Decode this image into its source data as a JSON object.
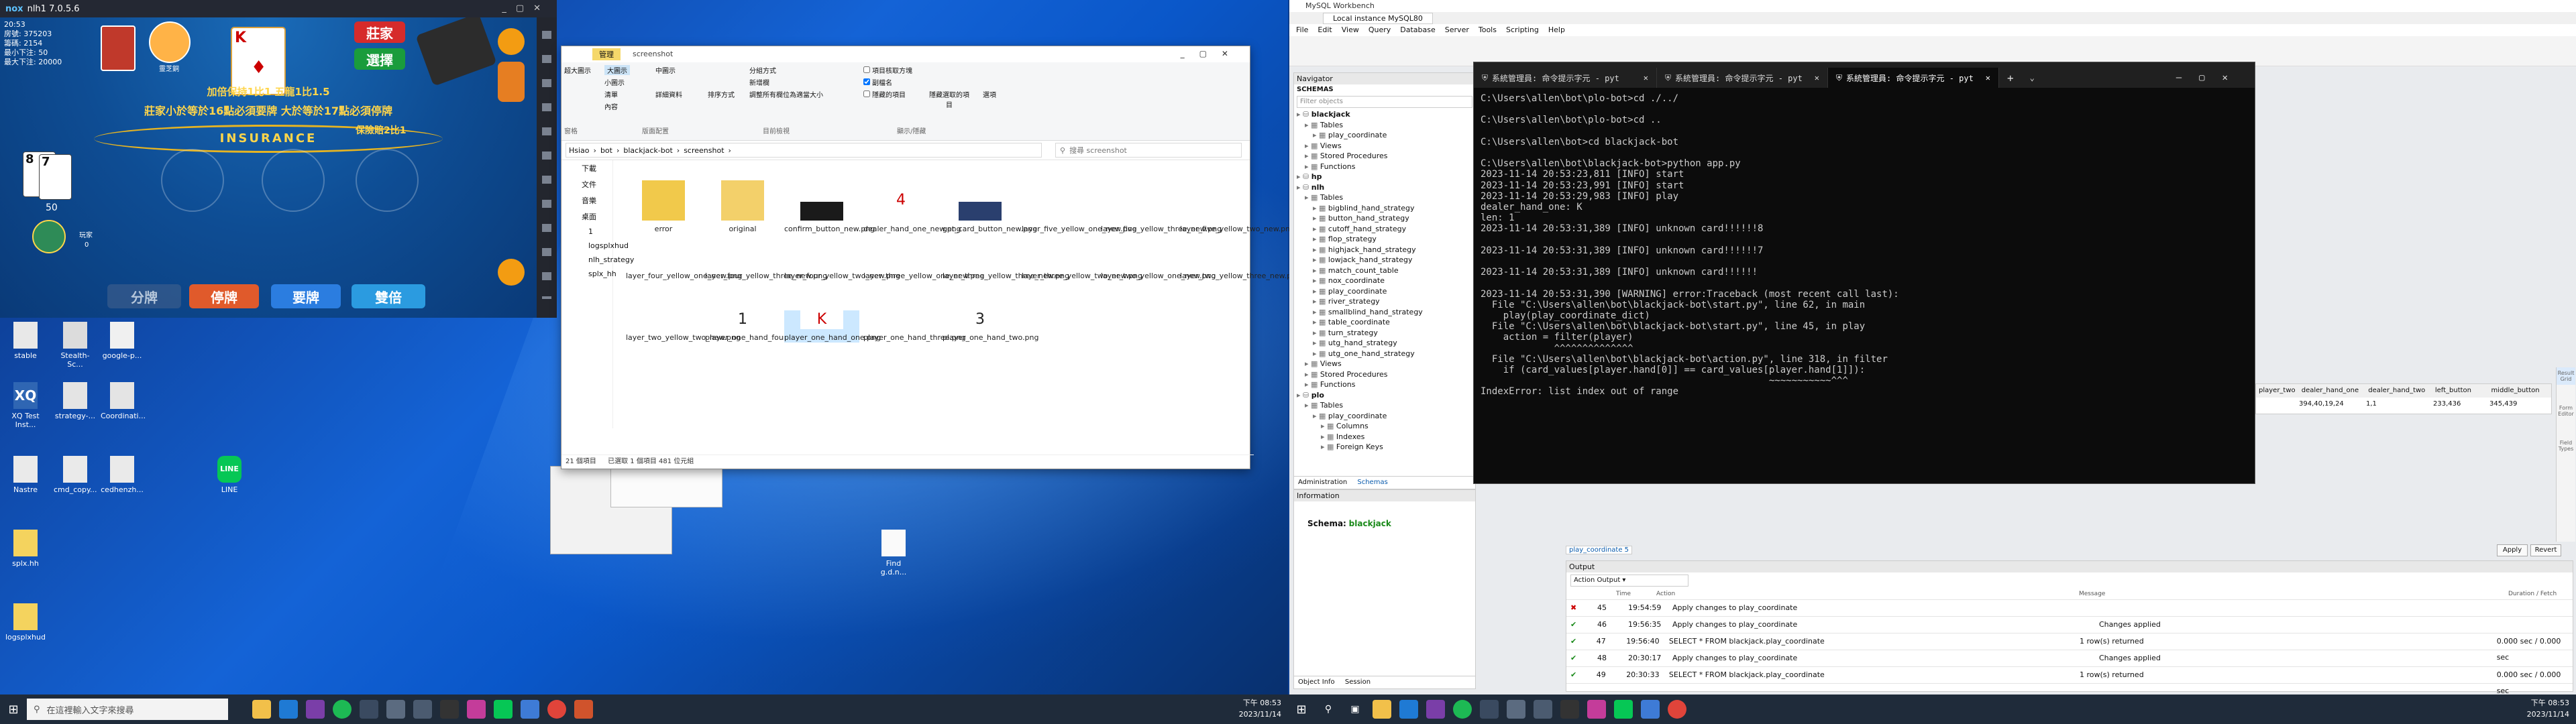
{
  "left_desktop": {
    "icons": [
      {
        "label": "stable"
      },
      {
        "label": "Stealth-Sc..."
      },
      {
        "label": "google-p..."
      },
      {
        "label": "XQ Test Inst..."
      },
      {
        "label": "strategy-..."
      },
      {
        "label": "Coordinati..."
      },
      {
        "label": "Nastre"
      },
      {
        "label": "cmd_copy..."
      },
      {
        "label": "cedhenzh..."
      },
      {
        "label": "LINE"
      },
      {
        "label": "splx.hh"
      },
      {
        "label": "Find g.d.n..."
      },
      {
        "label": "logsplxhud"
      }
    ],
    "taskbar": {
      "search_placeholder": "在這裡輸入文字來搜尋",
      "time": "下午 08:53",
      "date": "2023/11/14"
    }
  },
  "game": {
    "title": "nlh1 7.0.5.6",
    "app": "nox",
    "time": "20:53",
    "stats": {
      "line1": "房號: 375203",
      "line2": "籌碼: 2154",
      "line3": "最小下注: 50",
      "line4": "最大下注: 20000"
    },
    "avatar_name": "靈芝銅",
    "buttons": {
      "stand": "莊家",
      "rules": "選擇"
    },
    "table_text": {
      "arc1": "莊家小於等於16點必須要牌  大於等於17點必須停牌",
      "arc2": "加倍保持1比1  五龍1比1.5",
      "insurance": "INSURANCE",
      "insurance_pay": "保險賠2比1"
    },
    "player_cards": [
      "8",
      "7"
    ],
    "player_bet": "50",
    "player_label": "玩家",
    "player_chips": "0",
    "dealer_card": "K",
    "actions": [
      {
        "label": "分牌"
      },
      {
        "label": "停牌"
      },
      {
        "label": "要牌"
      },
      {
        "label": "雙倍"
      }
    ]
  },
  "explorer": {
    "title": "screenshot",
    "tab_manage": "管理",
    "ribbon": {
      "large_icons": "大圖示",
      "medium_icons": "中圖示",
      "small_icons": "小圖示",
      "list": "清單",
      "details": "詳細資料",
      "content": "內容",
      "sort": "排序方式",
      "group": "分組方式",
      "add_column": "新增欄",
      "size_all": "調整所有欄位為適當大小",
      "item_checkbox": "項目核取方塊",
      "extensions": "副檔名",
      "hidden": "隱藏的項目",
      "hide_selected": "隱藏選取的項目",
      "options": "選項",
      "layout_group": "版面配置",
      "current_view": "目前檢視",
      "show_hide": "顯示/隱藏",
      "pane": "窗格",
      "extra_large": "超大圖示"
    },
    "path": [
      "Hsiao",
      "bot",
      "blackjack-bot",
      "screenshot"
    ],
    "search_placeholder": "搜尋 screenshot",
    "sidebar": [
      {
        "label": "下載"
      },
      {
        "label": "文件"
      },
      {
        "label": "音樂"
      },
      {
        "label": "桌面"
      },
      {
        "label": "1"
      },
      {
        "label": "logsplxhud"
      },
      {
        "label": "nlh_strategy"
      },
      {
        "label": "splx_hh"
      }
    ],
    "files": [
      {
        "name": "error"
      },
      {
        "name": "original"
      },
      {
        "name": "confirm_button_new.png"
      },
      {
        "name": "dealer_hand_one_new.png"
      },
      {
        "name": "get_card_button_new.png"
      },
      {
        "name": "layer_five_yellow_one_new.png"
      },
      {
        "name": "layer_five_yellow_three_new.png"
      },
      {
        "name": "layer_five_yellow_two_new.png"
      },
      {
        "name": "layer_four_yellow_one_new.png"
      },
      {
        "name": "layer_four_yellow_three_new.png"
      },
      {
        "name": "layer_four_yellow_two_new.png"
      },
      {
        "name": "layer_three_yellow_one_new.png"
      },
      {
        "name": "layer_three_yellow_three_new.png"
      },
      {
        "name": "layer_three_yellow_two_new.png"
      },
      {
        "name": "layer_two_yellow_one_new.png"
      },
      {
        "name": "layer_two_yellow_three_new.png"
      },
      {
        "name": "layer_two_yellow_two_new.png"
      },
      {
        "name": "player_one_hand_four.png"
      },
      {
        "name": "player_one_hand_one.png"
      },
      {
        "name": "player_one_hand_three.png"
      },
      {
        "name": "player_one_hand_two.png"
      }
    ],
    "status": {
      "count": "21 個項目",
      "selected": "已選取 1 個項目 481 位元組"
    }
  },
  "workbench": {
    "title": "MySQL Workbench",
    "instance_tab": "Local instance MySQL80",
    "menu": [
      "File",
      "Edit",
      "View",
      "Query",
      "Database",
      "Server",
      "Tools",
      "Scripting",
      "Help"
    ],
    "navigator": "Navigator",
    "schemas_label": "SCHEMAS",
    "filter_placeholder": "Filter objects",
    "tree": [
      {
        "label": "blackjack",
        "indent": 0
      },
      {
        "label": "Tables",
        "indent": 1
      },
      {
        "label": "play_coordinate",
        "indent": 2
      },
      {
        "label": "Views",
        "indent": 1
      },
      {
        "label": "Stored Procedures",
        "indent": 1
      },
      {
        "label": "Functions",
        "indent": 1
      },
      {
        "label": "hp",
        "indent": 0
      },
      {
        "label": "nlh",
        "indent": 0
      },
      {
        "label": "Tables",
        "indent": 1
      },
      {
        "label": "bigblind_hand_strategy",
        "indent": 2
      },
      {
        "label": "button_hand_strategy",
        "indent": 2
      },
      {
        "label": "cutoff_hand_strategy",
        "indent": 2
      },
      {
        "label": "flop_strategy",
        "indent": 2
      },
      {
        "label": "highjack_hand_strategy",
        "indent": 2
      },
      {
        "label": "lowjack_hand_strategy",
        "indent": 2
      },
      {
        "label": "match_count_table",
        "indent": 2
      },
      {
        "label": "nox_coordinate",
        "indent": 2
      },
      {
        "label": "play_coordinate",
        "indent": 2
      },
      {
        "label": "river_strategy",
        "indent": 2
      },
      {
        "label": "smallblind_hand_strategy",
        "indent": 2
      },
      {
        "label": "table_coordinate",
        "indent": 2
      },
      {
        "label": "turn_strategy",
        "indent": 2
      },
      {
        "label": "utg_hand_strategy",
        "indent": 2
      },
      {
        "label": "utg_one_hand_strategy",
        "indent": 2
      },
      {
        "label": "Views",
        "indent": 1
      },
      {
        "label": "Stored Procedures",
        "indent": 1
      },
      {
        "label": "Functions",
        "indent": 1
      },
      {
        "label": "plo",
        "indent": 0
      },
      {
        "label": "Tables",
        "indent": 1
      },
      {
        "label": "play_coordinate",
        "indent": 2
      },
      {
        "label": "Columns",
        "indent": 3
      },
      {
        "label": "Indexes",
        "indent": 3
      },
      {
        "label": "Foreign Keys",
        "indent": 3
      }
    ],
    "nav_tabs": {
      "admin": "Administration",
      "schemas": "Schemas"
    },
    "info_label": "Information",
    "schema_info_label": "Schema:",
    "schema_info_value": "blackjack",
    "info_tabs": {
      "object": "Object Info",
      "session": "Session"
    },
    "result_columns": [
      "player_two",
      "dealer_hand_one",
      "dealer_hand_two",
      "left_button",
      "middle_button"
    ],
    "result_values": [
      "394,40,19,24",
      "1,1",
      "233,436",
      "345,439"
    ],
    "result_tab": "play_coordinate 5",
    "apply": "Apply",
    "revert": "Revert",
    "right_panel": [
      "Result Grid",
      "Form Editor",
      "Field Types"
    ],
    "output_label": "Output",
    "action_output": "Action Output",
    "output_headers": {
      "time": "Time",
      "action": "Action",
      "message": "Message",
      "duration": "Duration / Fetch"
    },
    "output_rows": [
      {
        "status": "err",
        "num": "45",
        "time": "19:54:59",
        "action": "Apply changes to play_coordinate",
        "message": "",
        "duration": ""
      },
      {
        "status": "ok",
        "num": "46",
        "time": "19:56:35",
        "action": "Apply changes to play_coordinate",
        "message": "Changes applied",
        "duration": ""
      },
      {
        "status": "ok",
        "num": "47",
        "time": "19:56:40",
        "action": "SELECT * FROM blackjack.play_coordinate",
        "message": "1 row(s) returned",
        "duration": "0.000 sec / 0.000 sec"
      },
      {
        "status": "ok",
        "num": "48",
        "time": "20:30:17",
        "action": "Apply changes to play_coordinate",
        "message": "Changes applied",
        "duration": ""
      },
      {
        "status": "ok",
        "num": "49",
        "time": "20:30:33",
        "action": "SELECT * FROM blackjack.play_coordinate",
        "message": "1 row(s) returned",
        "duration": "0.000 sec / 0.000 sec"
      }
    ],
    "taskbar": {
      "time": "下午 08:53",
      "date": "2023/11/14"
    }
  },
  "terminal": {
    "tabs": [
      {
        "label": "系統管理員: 命令提示字元 - pyt"
      },
      {
        "label": "系統管理員: 命令提示字元 - pyt"
      },
      {
        "label": "系統管理員: 命令提示字元 - pyt"
      }
    ],
    "output": "C:\\Users\\allen\\bot\\plo-bot>cd ./../\n\nC:\\Users\\allen\\bot\\plo-bot>cd ..\n\nC:\\Users\\allen\\bot>cd blackjack-bot\n\nC:\\Users\\allen\\bot\\blackjack-bot>python app.py\n2023-11-14 20:53:23,811 [INFO] start\n2023-11-14 20:53:23,991 [INFO] start\n2023-11-14 20:53:29,983 [INFO] play\ndealer_hand_one: K\nlen: 1\n2023-11-14 20:53:31,389 [INFO] unknown card!!!!!!8\n\n2023-11-14 20:53:31,389 [INFO] unknown card!!!!!!7\n\n2023-11-14 20:53:31,389 [INFO] unknown card!!!!!!\n\n2023-11-14 20:53:31,390 [WARNING] error:Traceback (most recent call last):\n  File \"C:\\Users\\allen\\bot\\blackjack-bot\\start.py\", line 62, in main\n    play(play_coordinate_dict)\n  File \"C:\\Users\\allen\\bot\\blackjack-bot\\start.py\", line 45, in play\n    action = filter(player)\n             ^^^^^^^^^^^^^^\n  File \"C:\\Users\\allen\\bot\\blackjack-bot\\action.py\", line 318, in filter\n    if (card_values[player.hand[0]] == card_values[player.hand[1]]):\n                                                   ~~~~~~~~~~~^^^\nIndexError: list index out of range\n"
  }
}
